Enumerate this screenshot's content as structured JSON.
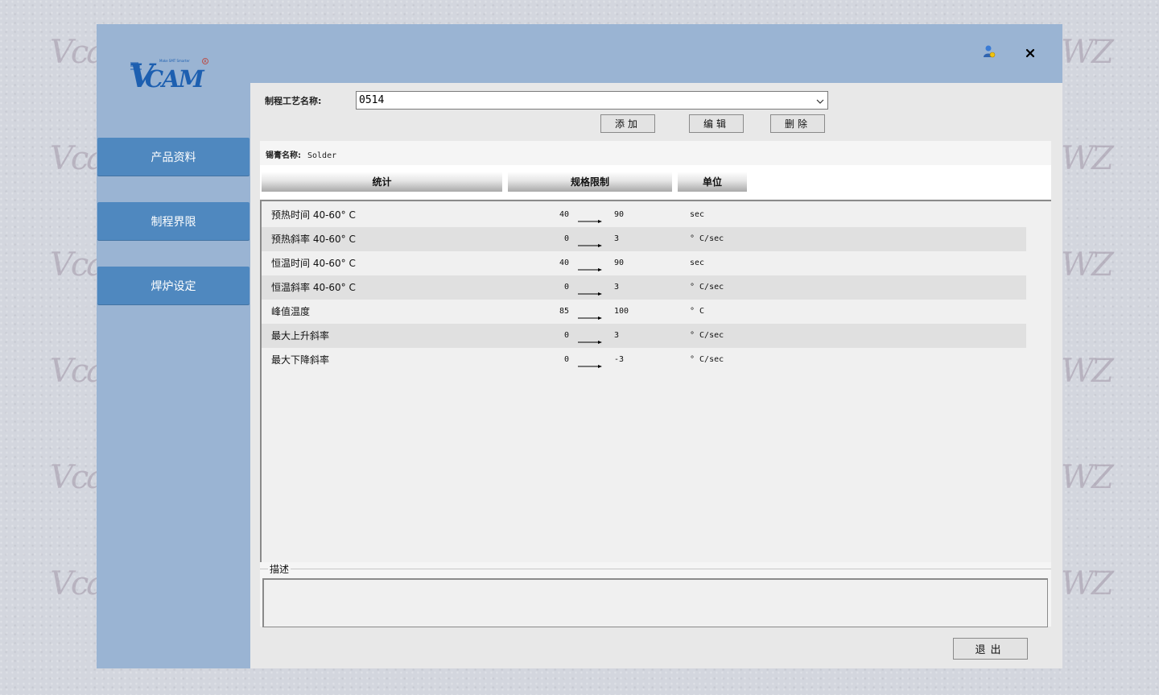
{
  "brand": {
    "logo_text": "VCAM",
    "tagline": "Make SMT Smarter"
  },
  "window_controls": {
    "user_icon": "user-icon",
    "close_icon": "close-icon"
  },
  "sidebar": {
    "items": [
      {
        "label": "产品资料"
      },
      {
        "label": "制程界限"
      },
      {
        "label": "焊炉设定"
      }
    ]
  },
  "process": {
    "label": "制程工艺名称:",
    "selected": "0514"
  },
  "toolbar": {
    "add_label": "添加",
    "edit_label": "编辑",
    "delete_label": "删除"
  },
  "solder": {
    "label": "锡膏名称:",
    "value": "Solder"
  },
  "table": {
    "headers": [
      "统计",
      "规格限制",
      "单位"
    ],
    "rows": [
      {
        "name": "预热时间 40-60° C",
        "min": "40",
        "max": "90",
        "unit": "sec"
      },
      {
        "name": "预热斜率 40-60° C",
        "min": "0",
        "max": "3",
        "unit": "° C/sec"
      },
      {
        "name": "恒温时间 40-60° C",
        "min": "40",
        "max": "90",
        "unit": "sec"
      },
      {
        "name": "恒温斜率 40-60° C",
        "min": "0",
        "max": "3",
        "unit": "° C/sec"
      },
      {
        "name": "峰值温度",
        "min": "85",
        "max": "100",
        "unit": "° C"
      },
      {
        "name": "最大上升斜率",
        "min": "0",
        "max": "3",
        "unit": "° C/sec"
      },
      {
        "name": "最大下降斜率",
        "min": "0",
        "max": "-3",
        "unit": "° C/sec"
      }
    ]
  },
  "description": {
    "label": "描述",
    "value": ""
  },
  "footer": {
    "exit_label": "退出"
  },
  "colors": {
    "window": "#9ab4d3",
    "nav": "#4f88bf",
    "content": "#e8e8e8"
  }
}
